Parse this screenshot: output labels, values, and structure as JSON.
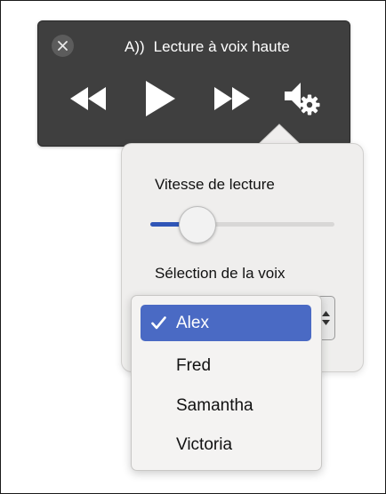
{
  "player": {
    "title_icon": "A))",
    "title": "Lecture à voix haute",
    "buttons": [
      "close-icon",
      "rewind-icon",
      "play-icon",
      "fast-forward-icon",
      "speaker-settings-icon"
    ]
  },
  "settings": {
    "speed_label": "Vitesse de lecture",
    "speed_value": 0.25,
    "voice_label": "Sélection de la voix"
  },
  "voices": {
    "selected": "Alex",
    "options": [
      {
        "label": "Alex",
        "selected": true
      },
      {
        "label": "Fred",
        "selected": false
      },
      {
        "label": "Samantha",
        "selected": false
      },
      {
        "label": "Victoria",
        "selected": false
      }
    ]
  },
  "colors": {
    "player_bg": "#3f3f3f",
    "accent": "#2f55b7",
    "selected_option": "#4a6ac4",
    "popover_bg": "#efeeed"
  }
}
